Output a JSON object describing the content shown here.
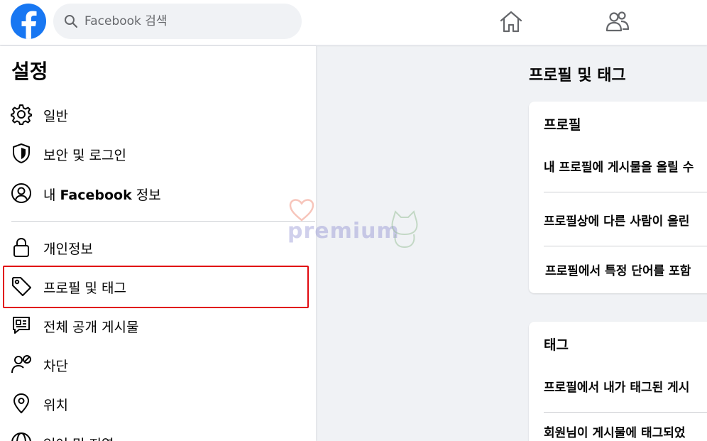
{
  "header": {
    "search_placeholder": "Facebook 검색",
    "nav": [
      {
        "icon": "home-icon"
      },
      {
        "icon": "friends-icon"
      }
    ]
  },
  "sidebar": {
    "title": "설정",
    "items": [
      {
        "label": "일반",
        "icon": "gear-icon"
      },
      {
        "label": "보안 및 로그인",
        "icon": "shield-icon"
      },
      {
        "label_prefix": "내 ",
        "label_bold": "Facebook",
        "label_suffix": " 정보",
        "icon": "user-circle-icon"
      },
      {
        "label": "개인정보",
        "icon": "lock-icon"
      },
      {
        "label": "프로필 및 태그",
        "icon": "tag-icon",
        "selected": true
      },
      {
        "label": "전체 공개 게시물",
        "icon": "public-post-icon"
      },
      {
        "label": "차단",
        "icon": "block-user-icon"
      },
      {
        "label": "위치",
        "icon": "location-pin-icon"
      },
      {
        "label": "언어 및 지역",
        "icon": "globe-icon"
      }
    ]
  },
  "main": {
    "title": "프로필 및 태그",
    "profile_card": {
      "title": "프로필",
      "rows": [
        "내 프로필에 게시물을 올릴 수",
        "프로필상에 다른 사람이 올린",
        "프로필에서 특정 단어를 포함"
      ]
    },
    "tag_card": {
      "title": "태그",
      "rows": [
        "프로필에서 내가 태그된 게시",
        "회원님이 게시물에 태그되었"
      ]
    }
  },
  "watermark": {
    "text": "premium"
  },
  "colors": {
    "brand": "#1877f2",
    "selection_outline": "#e1080f",
    "background": "#f0f2f5"
  }
}
